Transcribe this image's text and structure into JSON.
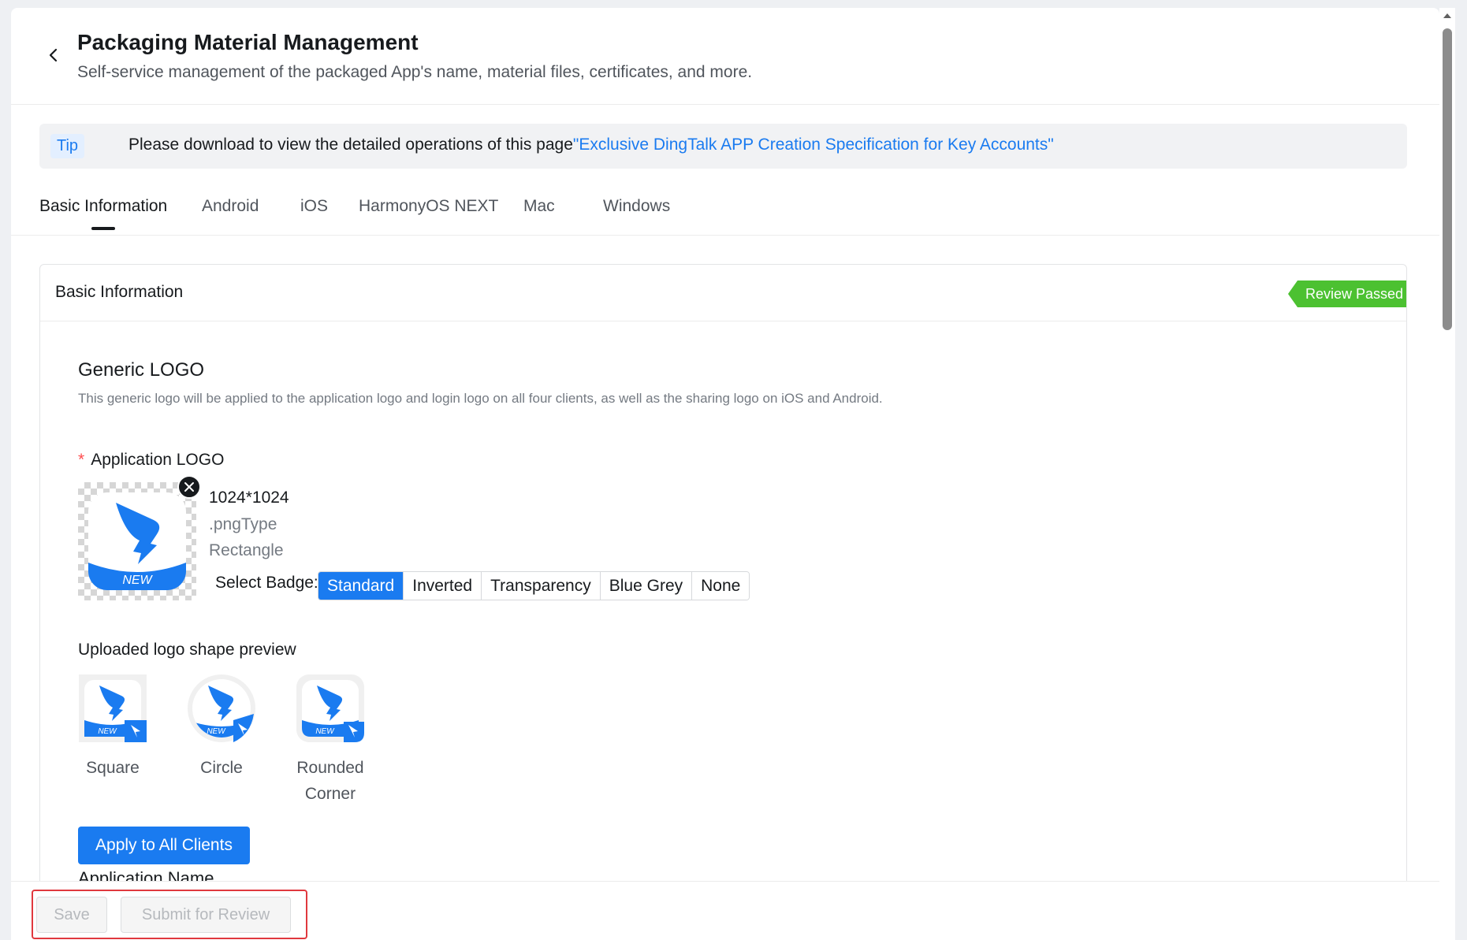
{
  "header": {
    "title": "Packaging Material Management",
    "subtitle": "Self-service management of the packaged App's name, material files, certificates, and more."
  },
  "tip": {
    "badge": "Tip",
    "text": "Please download to view the detailed operations of this page",
    "link": "\"Exclusive DingTalk APP Creation Specification for Key Accounts\""
  },
  "tabs": [
    {
      "label": "Basic Information",
      "active": true
    },
    {
      "label": "Android",
      "active": false
    },
    {
      "label": "iOS",
      "active": false
    },
    {
      "label": "HarmonyOS NEXT",
      "active": false
    },
    {
      "label": "Mac",
      "active": false
    },
    {
      "label": "Windows",
      "active": false
    }
  ],
  "section": {
    "title": "Basic Information",
    "status": "Review Passed",
    "status_color": "#4cc131"
  },
  "generic_logo": {
    "title": "Generic LOGO",
    "description": "This generic logo will be applied to the application logo and login logo on all four clients, as well as the sharing logo on iOS and Android."
  },
  "app_logo": {
    "required_mark": "*",
    "label": "Application LOGO",
    "badge_text": "NEW",
    "size": "1024*1024",
    "type": ".pngType",
    "shape": "Rectangle",
    "select_badge_label": "Select Badge:",
    "badges": [
      "Standard",
      "Inverted",
      "Transparency",
      "Blue Grey",
      "None"
    ],
    "selected_badge": "Standard"
  },
  "preview": {
    "title": "Uploaded logo shape preview",
    "mini_badge_text": "NEW",
    "shapes": [
      {
        "label": "Square"
      },
      {
        "label": "Circle"
      },
      {
        "label": "Rounded Corner"
      }
    ]
  },
  "apply_button": "Apply to All Clients",
  "next_field_label": "Application Name",
  "footer": {
    "save": "Save",
    "submit": "Submit for Review"
  },
  "colors": {
    "primary": "#1a7bf0",
    "success": "#4cc131",
    "highlight": "#e0383e"
  }
}
